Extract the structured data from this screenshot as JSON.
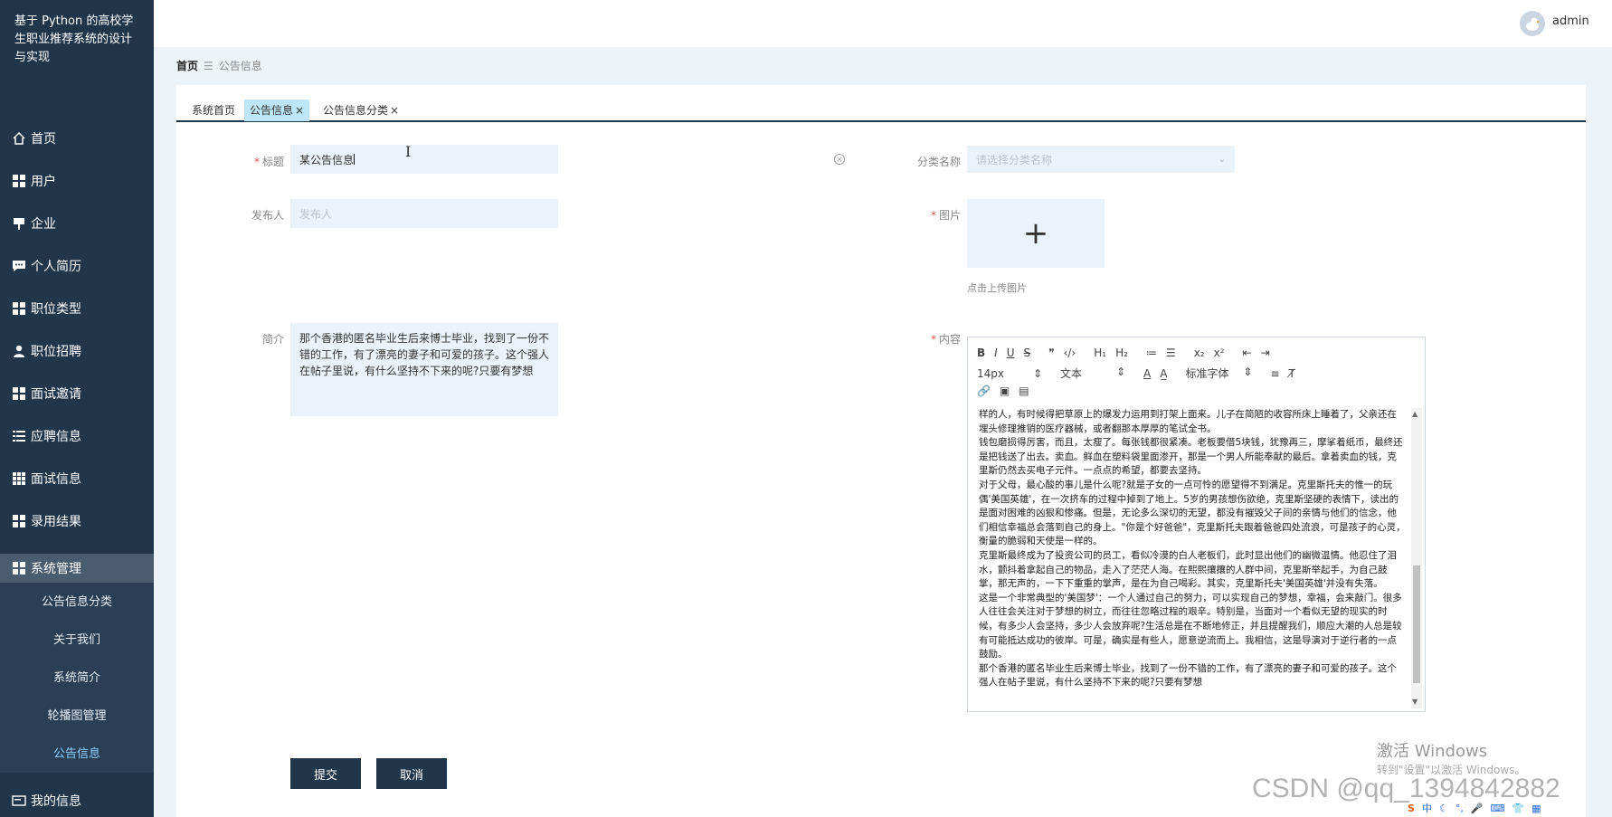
{
  "app": {
    "title": "基于 Python 的高校学生职业推荐系统的设计与实现"
  },
  "sidebar": {
    "items": [
      {
        "label": "首页",
        "icon": "home-icon"
      },
      {
        "label": "用户",
        "icon": "grid-icon"
      },
      {
        "label": "企业",
        "icon": "flag-icon"
      },
      {
        "label": "个人简历",
        "icon": "chat-icon"
      },
      {
        "label": "职位类型",
        "icon": "grid-icon"
      },
      {
        "label": "职位招聘",
        "icon": "user-icon"
      },
      {
        "label": "面试邀请",
        "icon": "grid-icon"
      },
      {
        "label": "应聘信息",
        "icon": "list-icon"
      },
      {
        "label": "面试信息",
        "icon": "apps-icon"
      },
      {
        "label": "录用结果",
        "icon": "grid-icon"
      },
      {
        "label": "系统管理",
        "icon": "grid-icon"
      },
      {
        "label": "我的信息",
        "icon": "card-icon"
      }
    ],
    "sub_items": [
      {
        "label": "公告信息分类"
      },
      {
        "label": "关于我们"
      },
      {
        "label": "系统简介"
      },
      {
        "label": "轮播图管理"
      },
      {
        "label": "公告信息"
      }
    ]
  },
  "header": {
    "username": "admin"
  },
  "breadcrumb": {
    "home": "首页",
    "current": "公告信息"
  },
  "tabs": [
    {
      "label": "系统首页",
      "closable": false
    },
    {
      "label": "公告信息",
      "closable": true
    },
    {
      "label": "公告信息分类",
      "closable": true
    }
  ],
  "tab_close_glyph": "×",
  "form": {
    "title": {
      "label": "标题",
      "value": "某公告信息"
    },
    "category": {
      "label": "分类名称",
      "placeholder": "请选择分类名称"
    },
    "publisher": {
      "label": "发布人",
      "placeholder": "发布人"
    },
    "image": {
      "label": "图片",
      "hint": "点击上传图片",
      "plus": "+"
    },
    "intro": {
      "label": "简介",
      "value": "那个香港的匿名毕业生后来博士毕业，找到了一份不错的工作，有了漂亮的妻子和可爱的孩子。这个强人在帖子里说，有什么坚持不下来的呢?只要有梦想"
    },
    "content": {
      "label": "内容"
    },
    "required_mark": "*"
  },
  "editor": {
    "toolbar_row1": [
      "B",
      "I",
      "U",
      "S",
      "❞",
      "‹/›",
      "H₁",
      "H₂",
      "≔",
      "☰",
      "x₂",
      "x²",
      "⇤",
      "⇥"
    ],
    "font_size": "14px",
    "block_format": "文本",
    "font_family": "标准字体",
    "toolbar_row2_icons": [
      "A",
      "A̲",
      "≡",
      "T̸"
    ],
    "toolbar_row3": [
      "🔗",
      "▣",
      "▤"
    ],
    "paragraphs": [
      "样的人，有时候得把草原上的爆发力运用到打架上面来。儿子在简陋的收容所床上睡着了，父亲还在埋头修理推销的医疗器械，或者翻那本厚厚的笔试全书。",
      "钱包磨损得厉害，而且，太瘦了。每张钱都很紧凑。老板要借5块钱，犹豫再三，摩挲着纸币，最终还是把钱送了出去。卖血。鲜血在塑料袋里面渗开，那是一个男人所能奉献的最后。拿着卖血的钱，克里斯仍然去买电子元件。一点点的希望，都要去坚持。",
      "对于父母，最心酸的事儿是什么呢?就是子女的一点可怜的愿望得不到满足。克里斯托夫的惟一的玩偶'美国英雄'，在一次挤车的过程中掉到了地上。5岁的男孩想伤欲绝，克里斯坚硬的表情下，读出的是面对困难的凶狠和惨痛。但是，无论多么深切的无望，都没有摧毁父子间的亲情与他们的信念，他们相信幸福总会落到自己的身上。\"你是个好爸爸\"，克里斯托夫跟着爸爸四处流浪，可是孩子的心灵，衡量的脆弱和天使是一样的。",
      "克里斯最终成为了投资公司的员工，看似冷漠的白人老板们，此时显出他们的幽微温情。他忍住了泪水，颤抖着拿起自己的物品，走入了茫茫人海。在熙熙攘攘的人群中间，克里斯举起手，为自己鼓掌，那无声的，一下下重重的掌声，是在为自己喝彩。其实，克里斯托夫'美国英雄'并没有失落。",
      "这是一个非常典型的'美国梦'：一个人通过自己的努力，可以实现自己的梦想，幸福，会来敲门。很多人往往会关注对于梦想的树立，而往往忽略过程的艰辛。特别是，当面对一个看似无望的现实的时候，有多少人会坚持，多少人会放弃呢?生活总是在不断地修正，并且提醒我们，顺应大潮的人总是较有可能抵达成功的彼岸。可是，确实是有些人，愿意逆流而上。我相信，这是导演对于逆行者的一点鼓励。",
      "那个香港的匿名毕业生后来博士毕业，找到了一份不错的工作，有了漂亮的妻子和可爱的孩子。这个强人在帖子里说，有什么坚持不下来的呢?只要有梦想"
    ]
  },
  "actions": {
    "submit": "提交",
    "cancel": "取消"
  },
  "overlay": {
    "activate_windows": "激活 Windows",
    "activate_hint": "转到\"设置\"以激活 Windows。",
    "csdn": "CSDN @qq_1394842882"
  },
  "colors": {
    "sidebar_bg": "#22364b",
    "accent": "#22364b",
    "field_bg": "#eaf3fb",
    "active_tab": "#bde6f6"
  }
}
